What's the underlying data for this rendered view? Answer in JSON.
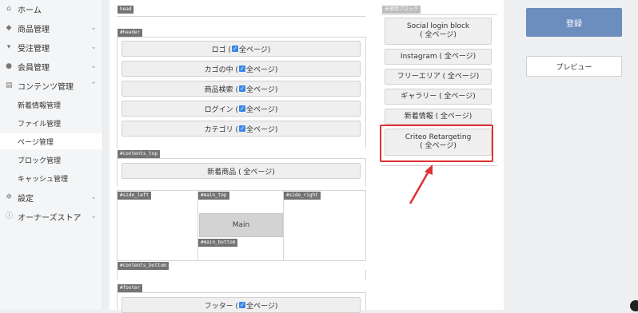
{
  "sidebar": {
    "items": [
      {
        "label": "ホーム",
        "icon": "home-icon"
      },
      {
        "label": "商品管理",
        "icon": "tag-icon"
      },
      {
        "label": "受注管理",
        "icon": "cart-icon"
      },
      {
        "label": "会員管理",
        "icon": "users-icon"
      },
      {
        "label": "コンテンツ管理",
        "icon": "document-icon"
      }
    ],
    "subitems": [
      {
        "label": "新着情報管理"
      },
      {
        "label": "ファイル管理"
      },
      {
        "label": "ページ管理"
      },
      {
        "label": "ブロック管理"
      },
      {
        "label": "キャッシュ管理"
      }
    ],
    "bottom_items": [
      {
        "label": "設定",
        "icon": "gear-icon"
      },
      {
        "label": "オーナーズストア",
        "icon": "info-icon"
      }
    ]
  },
  "layout": {
    "tags": {
      "head": "head",
      "header": "#header",
      "contents_top": "#contents_top",
      "side_left": "#side_left",
      "main_top": "#main_top",
      "side_right": "#side_right",
      "main_bottom": "#main_bottom",
      "contents_bottom": "#contents_bottom",
      "footer": "#footer"
    },
    "header_blocks": [
      {
        "name": "ロゴ (",
        "suffix": "全ページ)"
      },
      {
        "name": "カゴの中 (",
        "suffix": "全ページ)"
      },
      {
        "name": "商品検索 (",
        "suffix": "全ページ)"
      },
      {
        "name": "ログイン (",
        "suffix": "全ページ)"
      },
      {
        "name": "カテゴリ (",
        "suffix": "全ページ)"
      }
    ],
    "contents_top_block": "新着商品 (  全ページ)",
    "main_label": "Main",
    "footer_block": {
      "name": "フッター (",
      "suffix": "全ページ)"
    }
  },
  "unused": {
    "tag": "未使用ブロック",
    "blocks": [
      {
        "line1": "Social login block",
        "line2": "(  全ページ)"
      },
      {
        "line1": "Instagram (  全ページ)",
        "line2": ""
      },
      {
        "line1": "フリーエリア (  全ページ)",
        "line2": ""
      },
      {
        "line1": "ギャラリー (  全ページ)",
        "line2": ""
      },
      {
        "line1": "新着情報 (  全ページ)",
        "line2": ""
      },
      {
        "line1": "Criteo Retargeting",
        "line2": "(  全ページ)"
      }
    ]
  },
  "actions": {
    "register": "登録",
    "preview": "プレビュー"
  },
  "colors": {
    "primary_button": "#6c8ebf",
    "highlight": "#e03131",
    "checkbox": "#3a86e8"
  }
}
